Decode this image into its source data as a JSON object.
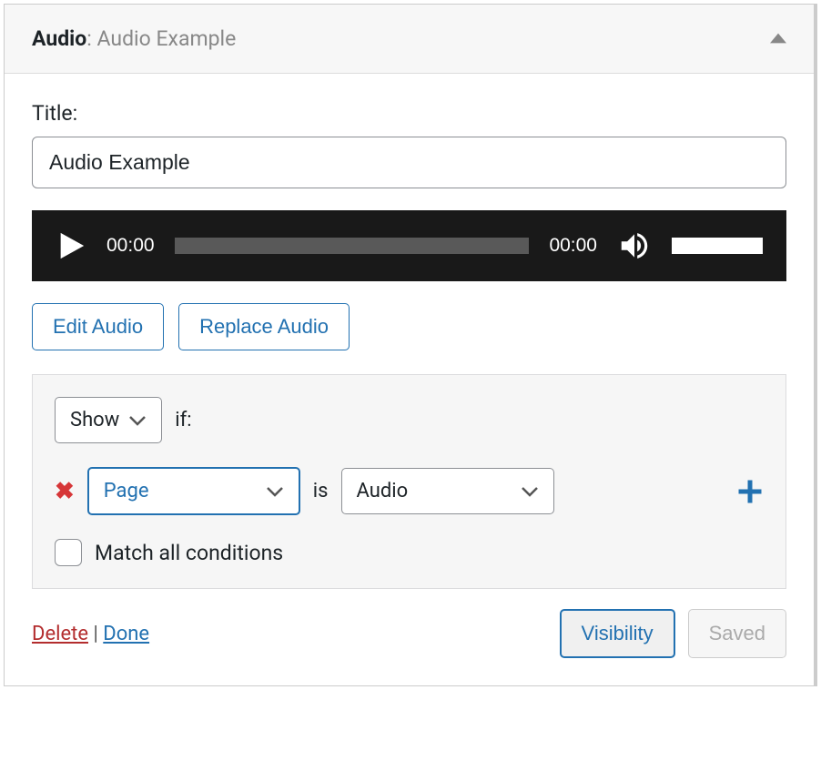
{
  "header": {
    "prefix": "Audio",
    "subtitle": ": Audio Example"
  },
  "title_field": {
    "label": "Title:",
    "value": "Audio Example"
  },
  "player": {
    "elapsed": "00:00",
    "duration": "00:00"
  },
  "buttons": {
    "edit": "Edit Audio",
    "replace": "Replace Audio",
    "visibility": "Visibility",
    "saved": "Saved"
  },
  "conditions": {
    "action": "Show",
    "if_text": "if:",
    "subject": "Page",
    "is_text": "is",
    "value": "Audio",
    "match_all_label": "Match all conditions"
  },
  "footer": {
    "delete": "Delete",
    "separator": " | ",
    "done": "Done"
  }
}
